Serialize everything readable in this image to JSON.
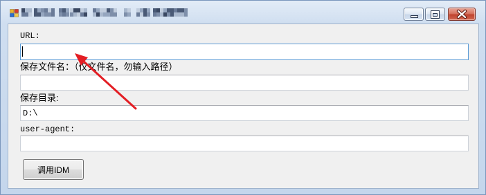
{
  "window": {
    "controls": [
      {
        "role": "minimize",
        "icon": "minimize-icon"
      },
      {
        "role": "maximize",
        "icon": "maximize-icon"
      },
      {
        "role": "close",
        "icon": "close-icon"
      }
    ],
    "app_icon": "app-icon"
  },
  "form": {
    "url": {
      "label": "URL:"
    },
    "filename": {
      "label": "保存文件名：（仅文件名，勿输入路径）"
    },
    "save_dir": {
      "label": "保存目录:",
      "value": "D:\\"
    },
    "user_agent": {
      "label": "user-agent:"
    },
    "submit": {
      "label": "调用IDM"
    }
  },
  "colors": {
    "frame": "#C4D6EC",
    "client_background": "#F0F0F0",
    "focus_border": "#5B9BD5",
    "close_button": "#C0432E",
    "annotation_arrow": "#E31E24"
  }
}
